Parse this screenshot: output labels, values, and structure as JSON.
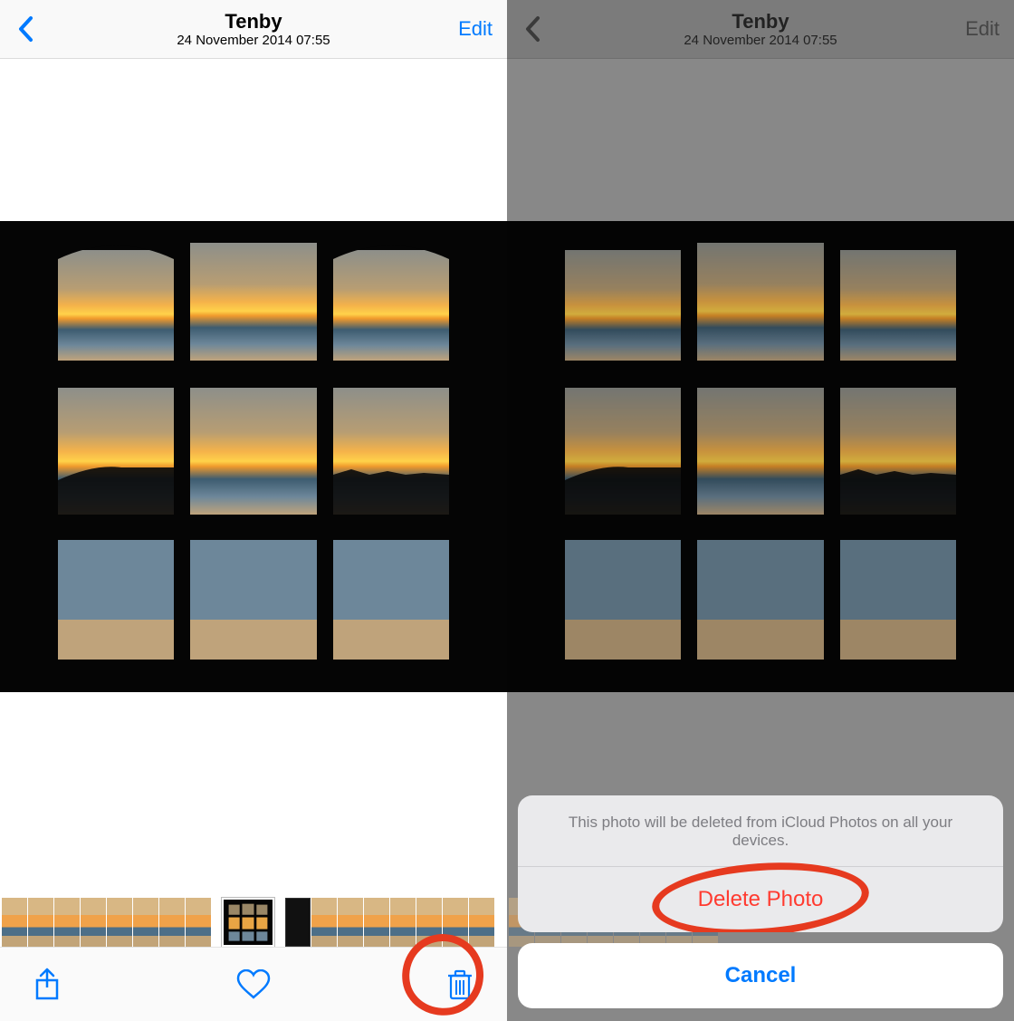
{
  "colors": {
    "ios_blue": "#007aff",
    "ios_red": "#ff3b30",
    "annotation_red": "#e63a1f"
  },
  "left": {
    "nav": {
      "title": "Tenby",
      "timestamp": "24 November 2014  07:55",
      "edit": "Edit"
    },
    "toolbar": {
      "share_icon": "share-icon",
      "favorite_icon": "heart-icon",
      "trash_icon": "trash-icon"
    },
    "thumb_count_before": 8,
    "thumb_count_after": 8
  },
  "right": {
    "nav": {
      "title": "Tenby",
      "timestamp": "24 November 2014  07:55",
      "edit": "Edit"
    },
    "sheet": {
      "message": "This photo will be deleted from iCloud Photos on all your devices.",
      "delete": "Delete Photo",
      "cancel": "Cancel"
    }
  }
}
